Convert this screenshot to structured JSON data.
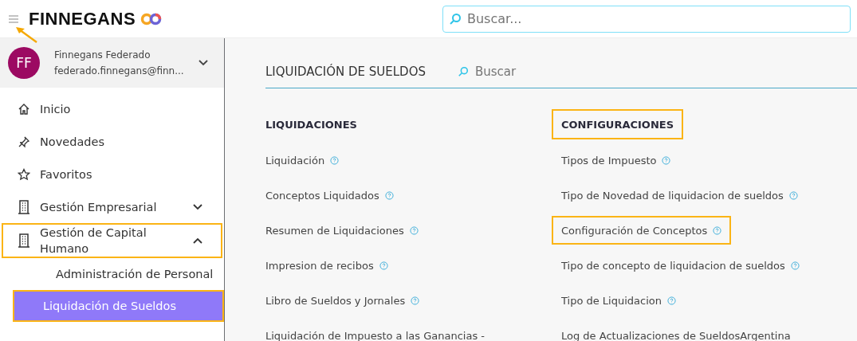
{
  "header": {
    "logo": "FINNEGANS",
    "search": {
      "placeholder": "Buscar..."
    }
  },
  "user": {
    "initials": "FF",
    "name": "Finnegans Federado",
    "email": "federado.finnegans@finn..."
  },
  "sidebar": {
    "items": [
      {
        "label": "Inicio",
        "kind": "home",
        "highlighted": false
      },
      {
        "label": "Novedades",
        "kind": "pin",
        "highlighted": false
      },
      {
        "label": "Favoritos",
        "kind": "star",
        "highlighted": false
      },
      {
        "label": "Gestión Empresarial",
        "kind": "building",
        "expanded": false,
        "highlighted": false
      },
      {
        "label": "Gestión de Capital Humano",
        "kind": "building",
        "expanded": true,
        "highlighted": true,
        "children": [
          {
            "label": "Administración de Personal",
            "selected": false,
            "highlighted": false
          },
          {
            "label": "Liquidación de Sueldos",
            "selected": true,
            "highlighted": true
          }
        ]
      }
    ]
  },
  "page": {
    "title": "LIQUIDACIÓN DE SUELDOS",
    "search": {
      "placeholder": "Buscar"
    },
    "columns": [
      {
        "heading": "LIQUIDACIONES",
        "highlighted": false,
        "links": [
          {
            "label": "Liquidación",
            "help": true,
            "highlighted": false
          },
          {
            "label": "Conceptos Liquidados",
            "help": true,
            "highlighted": false
          },
          {
            "label": "Resumen de Liquidaciones",
            "help": true,
            "highlighted": false
          },
          {
            "label": "Impresion de recibos",
            "help": true,
            "highlighted": false
          },
          {
            "label": "Libro de Sueldos y Jornales",
            "help": true,
            "highlighted": false
          },
          {
            "label": "Liquidación de Impuesto a las Ganancias -",
            "help": false,
            "highlighted": false
          }
        ]
      },
      {
        "heading": "CONFIGURACIONES",
        "highlighted": true,
        "links": [
          {
            "label": "Tipos de Impuesto",
            "help": true,
            "highlighted": false
          },
          {
            "label": "Tipo de Novedad de liquidacion de sueldos",
            "help": true,
            "highlighted": false
          },
          {
            "label": "Configuración de Conceptos",
            "help": true,
            "highlighted": true
          },
          {
            "label": "Tipo de concepto de liquidacion de sueldos",
            "help": true,
            "highlighted": false
          },
          {
            "label": "Tipo de Liquidacion",
            "help": true,
            "highlighted": false
          },
          {
            "label": "Log de Actualizaciones de SueldosArgentina",
            "help": false,
            "highlighted": false
          }
        ]
      }
    ]
  }
}
